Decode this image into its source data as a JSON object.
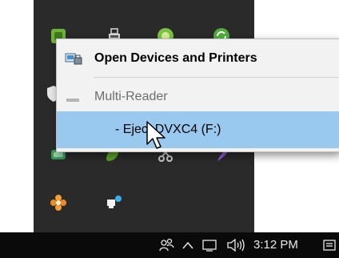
{
  "tray_overflow": {
    "icons": [
      {
        "name": "green-app-icon",
        "color": "#6fb23a"
      },
      {
        "name": "usb-drive-icon",
        "color": "#d0d0d0"
      },
      {
        "name": "green-circle-app-icon",
        "color": "#7cc242"
      },
      {
        "name": "green-sync-icon",
        "color": "#4fae3c"
      },
      {
        "name": "shield-icon",
        "color": "#e0e0e0"
      },
      {
        "name": "network-app-icon",
        "color": "#3a9a5a"
      },
      {
        "name": "green-leaf-icon",
        "color": "#5aa02c"
      },
      {
        "name": "scissors-icon",
        "color": "#cccccc"
      },
      {
        "name": "purple-feather-icon",
        "color": "#8a5bd0"
      },
      {
        "name": "orange-flower-icon",
        "color": "#f08a24"
      },
      {
        "name": "network-share-icon",
        "color": "#3ab0e8"
      }
    ]
  },
  "context_menu": {
    "open_devices": "Open Devices and Printers",
    "device_name": "Multi-Reader",
    "eject_item": "-  Eject DVXC4 (F:)"
  },
  "taskbar": {
    "icons": [
      "people-icon",
      "chevron-up-icon",
      "monitor-icon",
      "speaker-icon",
      "action-center-icon"
    ],
    "time": "3:12 PM"
  },
  "colors": {
    "tray_background": "#2a2a2a",
    "taskbar_background": "#0a0a0a",
    "menu_background": "#f2f2f2",
    "menu_highlight": "#99c9ef"
  }
}
